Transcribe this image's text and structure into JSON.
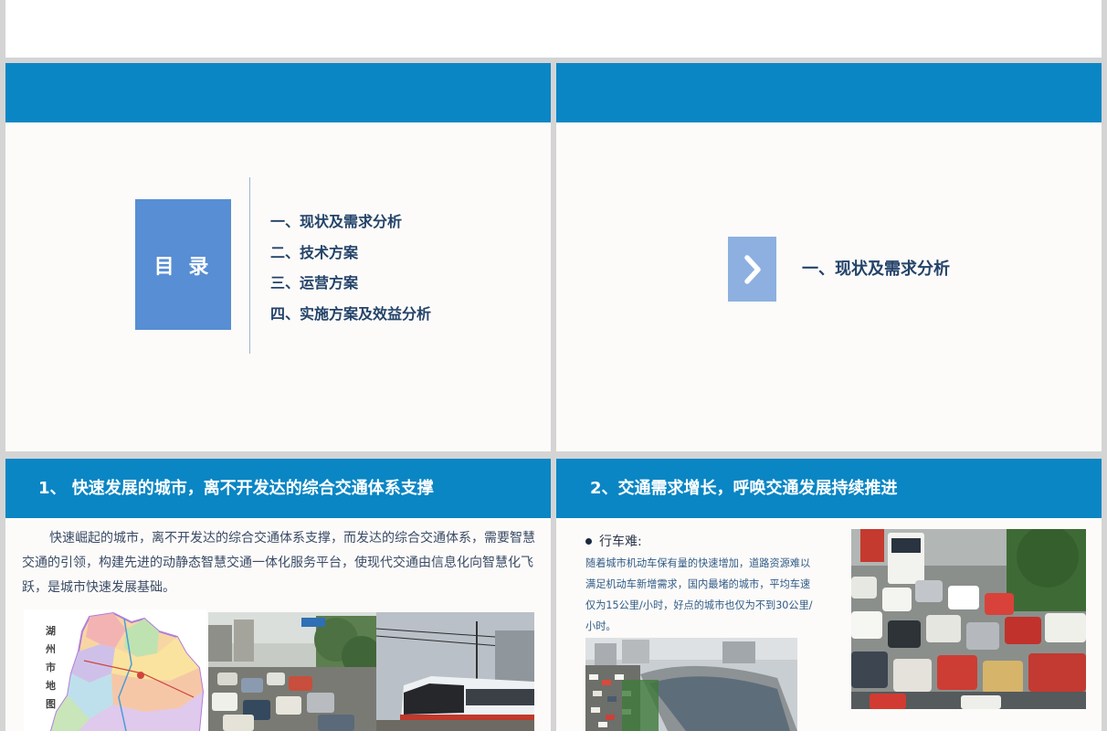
{
  "toc_slide": {
    "label": "目 录",
    "items": [
      "一、现状及需求分析",
      "二、技术方案",
      "三、运营方案",
      "四、实施方案及效益分析"
    ]
  },
  "section_slide": {
    "chevron_icon": "chevron-right-icon",
    "title": "一、现状及需求分析"
  },
  "slide3": {
    "title": "1、 快速发展的城市，离不开发达的综合交通体系支撑",
    "paragraph": "快速崛起的城市，离不开发达的综合交通体系支撑，而发达的综合交通体系，需要智慧交通的引领，构建先进的动静态智慧交通一体化服务平台，使现代交通由信息化向智慧化飞跃，是城市快速发展基础。",
    "map_caption": "湖州市地图"
  },
  "slide4": {
    "title": "2、交通需求增长，呼唤交通发展持续推进",
    "bullet_heading": "行车难:",
    "paragraph": "随着城市机动车保有量的快速增加，道路资源难以满足机动车新增需求，国内最堵的城市，平均车速仅为15公里/小时，好点的城市也仅为不到30公里/小时。"
  },
  "colors": {
    "header_blue": "#0a86c4",
    "toc_box": "#578ed4",
    "chevron_box": "#8db0e0",
    "heading_navy": "#24436a"
  }
}
